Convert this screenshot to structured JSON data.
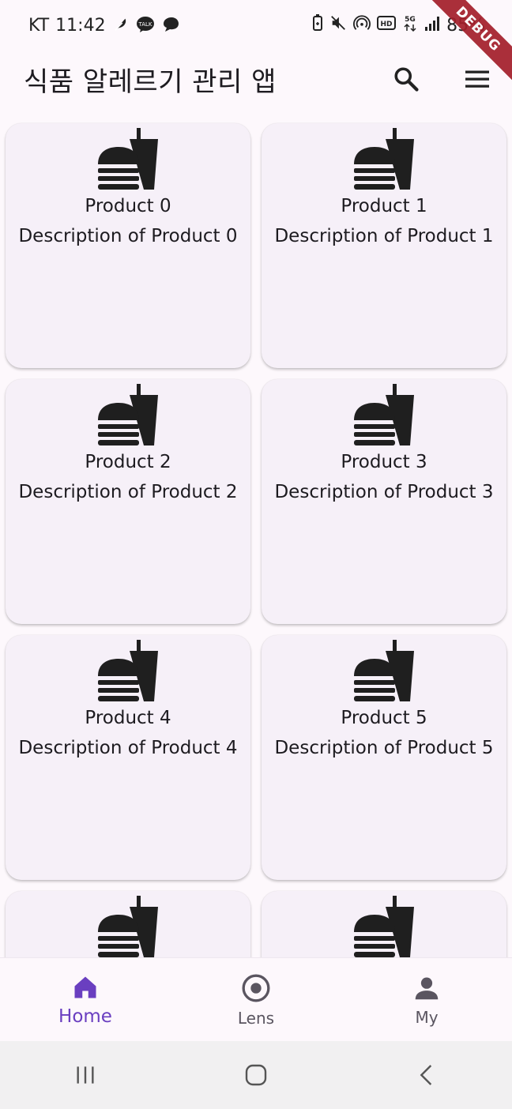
{
  "status_bar": {
    "carrier": "KT",
    "time": "11:42",
    "battery": "85%",
    "left_icons": [
      "feather-icon",
      "kakaotalk-icon",
      "chat-bubble-icon"
    ],
    "right_icons": [
      "battery-saver-icon",
      "mute-icon",
      "hotspot-icon",
      "hd-icon",
      "5g-icon",
      "signal-icon"
    ]
  },
  "debug_banner": "DEBUG",
  "app_bar": {
    "title": "식품 알레르기 관리 앱",
    "actions": [
      "search-icon",
      "menu-icon"
    ]
  },
  "products": [
    {
      "name": "Product 0",
      "description": "Description of Product 0",
      "icon": "fastfood-icon"
    },
    {
      "name": "Product 1",
      "description": "Description of Product 1",
      "icon": "fastfood-icon"
    },
    {
      "name": "Product 2",
      "description": "Description of Product 2",
      "icon": "fastfood-icon"
    },
    {
      "name": "Product 3",
      "description": "Description of Product 3",
      "icon": "fastfood-icon"
    },
    {
      "name": "Product 4",
      "description": "Description of Product 4",
      "icon": "fastfood-icon"
    },
    {
      "name": "Product 5",
      "description": "Description of Product 5",
      "icon": "fastfood-icon"
    },
    {
      "name": "",
      "description": "",
      "icon": "fastfood-icon"
    },
    {
      "name": "",
      "description": "",
      "icon": "fastfood-icon"
    }
  ],
  "bottom_nav": {
    "items": [
      {
        "label": "Home",
        "icon": "home-icon",
        "active": true
      },
      {
        "label": "Lens",
        "icon": "lens-icon",
        "active": false
      },
      {
        "label": "My",
        "icon": "person-icon",
        "active": false
      }
    ]
  },
  "colors": {
    "accent": "#6a3fc0",
    "background": "#fdf8fc",
    "card": "#f6f0f8",
    "debug": "#a31f2a"
  },
  "system_nav": [
    "recent-apps-icon",
    "home-circle-icon",
    "back-icon"
  ]
}
